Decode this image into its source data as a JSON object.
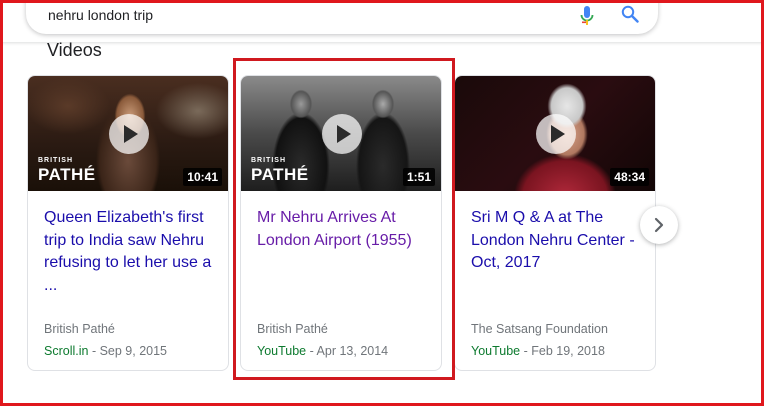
{
  "search": {
    "query": "nehru london trip"
  },
  "section": {
    "title": "Videos"
  },
  "videos": [
    {
      "title": "Queen Elizabeth's first trip to India saw Nehru refusing to let her use a ...",
      "source": "British Pathé",
      "site": "Scroll.in",
      "sep": " - ",
      "date": "Sep 9, 2015",
      "duration": "10:41",
      "watermark_top": "BRITISH",
      "watermark_bottom": "PATHÉ",
      "visited": false
    },
    {
      "title": "Mr Nehru Arrives At London Airport (1955)",
      "source": "British Pathé",
      "site": "YouTube",
      "sep": " - ",
      "date": "Apr 13, 2014",
      "duration": "1:51",
      "watermark_top": "BRITISH",
      "watermark_bottom": "PATHÉ",
      "visited": true
    },
    {
      "title": "Sri M Q & A at The London Nehru Center - Oct, 2017",
      "source": "The Satsang Foundation",
      "site": "YouTube",
      "sep": " - ",
      "date": "Feb 19, 2018",
      "duration": "48:34",
      "visited": false
    }
  ],
  "colors": {
    "link": "#1a0dab",
    "visited_link": "#681da8",
    "site_green": "#0d7a2f",
    "annotation_red": "#d0191f"
  },
  "icons": [
    "mic-icon",
    "search-icon",
    "play-icon",
    "chevron-right-icon"
  ]
}
